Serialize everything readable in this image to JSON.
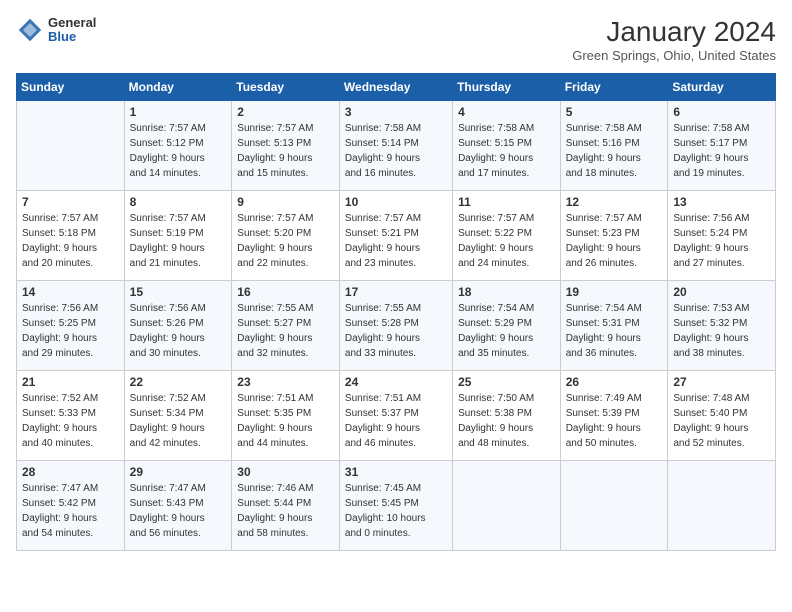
{
  "header": {
    "logo": {
      "line1": "General",
      "line2": "Blue"
    },
    "title": "January 2024",
    "subtitle": "Green Springs, Ohio, United States"
  },
  "days_of_week": [
    "Sunday",
    "Monday",
    "Tuesday",
    "Wednesday",
    "Thursday",
    "Friday",
    "Saturday"
  ],
  "weeks": [
    [
      {
        "num": "",
        "info": ""
      },
      {
        "num": "1",
        "info": "Sunrise: 7:57 AM\nSunset: 5:12 PM\nDaylight: 9 hours\nand 14 minutes."
      },
      {
        "num": "2",
        "info": "Sunrise: 7:57 AM\nSunset: 5:13 PM\nDaylight: 9 hours\nand 15 minutes."
      },
      {
        "num": "3",
        "info": "Sunrise: 7:58 AM\nSunset: 5:14 PM\nDaylight: 9 hours\nand 16 minutes."
      },
      {
        "num": "4",
        "info": "Sunrise: 7:58 AM\nSunset: 5:15 PM\nDaylight: 9 hours\nand 17 minutes."
      },
      {
        "num": "5",
        "info": "Sunrise: 7:58 AM\nSunset: 5:16 PM\nDaylight: 9 hours\nand 18 minutes."
      },
      {
        "num": "6",
        "info": "Sunrise: 7:58 AM\nSunset: 5:17 PM\nDaylight: 9 hours\nand 19 minutes."
      }
    ],
    [
      {
        "num": "7",
        "info": "Sunrise: 7:57 AM\nSunset: 5:18 PM\nDaylight: 9 hours\nand 20 minutes."
      },
      {
        "num": "8",
        "info": "Sunrise: 7:57 AM\nSunset: 5:19 PM\nDaylight: 9 hours\nand 21 minutes."
      },
      {
        "num": "9",
        "info": "Sunrise: 7:57 AM\nSunset: 5:20 PM\nDaylight: 9 hours\nand 22 minutes."
      },
      {
        "num": "10",
        "info": "Sunrise: 7:57 AM\nSunset: 5:21 PM\nDaylight: 9 hours\nand 23 minutes."
      },
      {
        "num": "11",
        "info": "Sunrise: 7:57 AM\nSunset: 5:22 PM\nDaylight: 9 hours\nand 24 minutes."
      },
      {
        "num": "12",
        "info": "Sunrise: 7:57 AM\nSunset: 5:23 PM\nDaylight: 9 hours\nand 26 minutes."
      },
      {
        "num": "13",
        "info": "Sunrise: 7:56 AM\nSunset: 5:24 PM\nDaylight: 9 hours\nand 27 minutes."
      }
    ],
    [
      {
        "num": "14",
        "info": "Sunrise: 7:56 AM\nSunset: 5:25 PM\nDaylight: 9 hours\nand 29 minutes."
      },
      {
        "num": "15",
        "info": "Sunrise: 7:56 AM\nSunset: 5:26 PM\nDaylight: 9 hours\nand 30 minutes."
      },
      {
        "num": "16",
        "info": "Sunrise: 7:55 AM\nSunset: 5:27 PM\nDaylight: 9 hours\nand 32 minutes."
      },
      {
        "num": "17",
        "info": "Sunrise: 7:55 AM\nSunset: 5:28 PM\nDaylight: 9 hours\nand 33 minutes."
      },
      {
        "num": "18",
        "info": "Sunrise: 7:54 AM\nSunset: 5:29 PM\nDaylight: 9 hours\nand 35 minutes."
      },
      {
        "num": "19",
        "info": "Sunrise: 7:54 AM\nSunset: 5:31 PM\nDaylight: 9 hours\nand 36 minutes."
      },
      {
        "num": "20",
        "info": "Sunrise: 7:53 AM\nSunset: 5:32 PM\nDaylight: 9 hours\nand 38 minutes."
      }
    ],
    [
      {
        "num": "21",
        "info": "Sunrise: 7:52 AM\nSunset: 5:33 PM\nDaylight: 9 hours\nand 40 minutes."
      },
      {
        "num": "22",
        "info": "Sunrise: 7:52 AM\nSunset: 5:34 PM\nDaylight: 9 hours\nand 42 minutes."
      },
      {
        "num": "23",
        "info": "Sunrise: 7:51 AM\nSunset: 5:35 PM\nDaylight: 9 hours\nand 44 minutes."
      },
      {
        "num": "24",
        "info": "Sunrise: 7:51 AM\nSunset: 5:37 PM\nDaylight: 9 hours\nand 46 minutes."
      },
      {
        "num": "25",
        "info": "Sunrise: 7:50 AM\nSunset: 5:38 PM\nDaylight: 9 hours\nand 48 minutes."
      },
      {
        "num": "26",
        "info": "Sunrise: 7:49 AM\nSunset: 5:39 PM\nDaylight: 9 hours\nand 50 minutes."
      },
      {
        "num": "27",
        "info": "Sunrise: 7:48 AM\nSunset: 5:40 PM\nDaylight: 9 hours\nand 52 minutes."
      }
    ],
    [
      {
        "num": "28",
        "info": "Sunrise: 7:47 AM\nSunset: 5:42 PM\nDaylight: 9 hours\nand 54 minutes."
      },
      {
        "num": "29",
        "info": "Sunrise: 7:47 AM\nSunset: 5:43 PM\nDaylight: 9 hours\nand 56 minutes."
      },
      {
        "num": "30",
        "info": "Sunrise: 7:46 AM\nSunset: 5:44 PM\nDaylight: 9 hours\nand 58 minutes."
      },
      {
        "num": "31",
        "info": "Sunrise: 7:45 AM\nSunset: 5:45 PM\nDaylight: 10 hours\nand 0 minutes."
      },
      {
        "num": "",
        "info": ""
      },
      {
        "num": "",
        "info": ""
      },
      {
        "num": "",
        "info": ""
      }
    ]
  ]
}
